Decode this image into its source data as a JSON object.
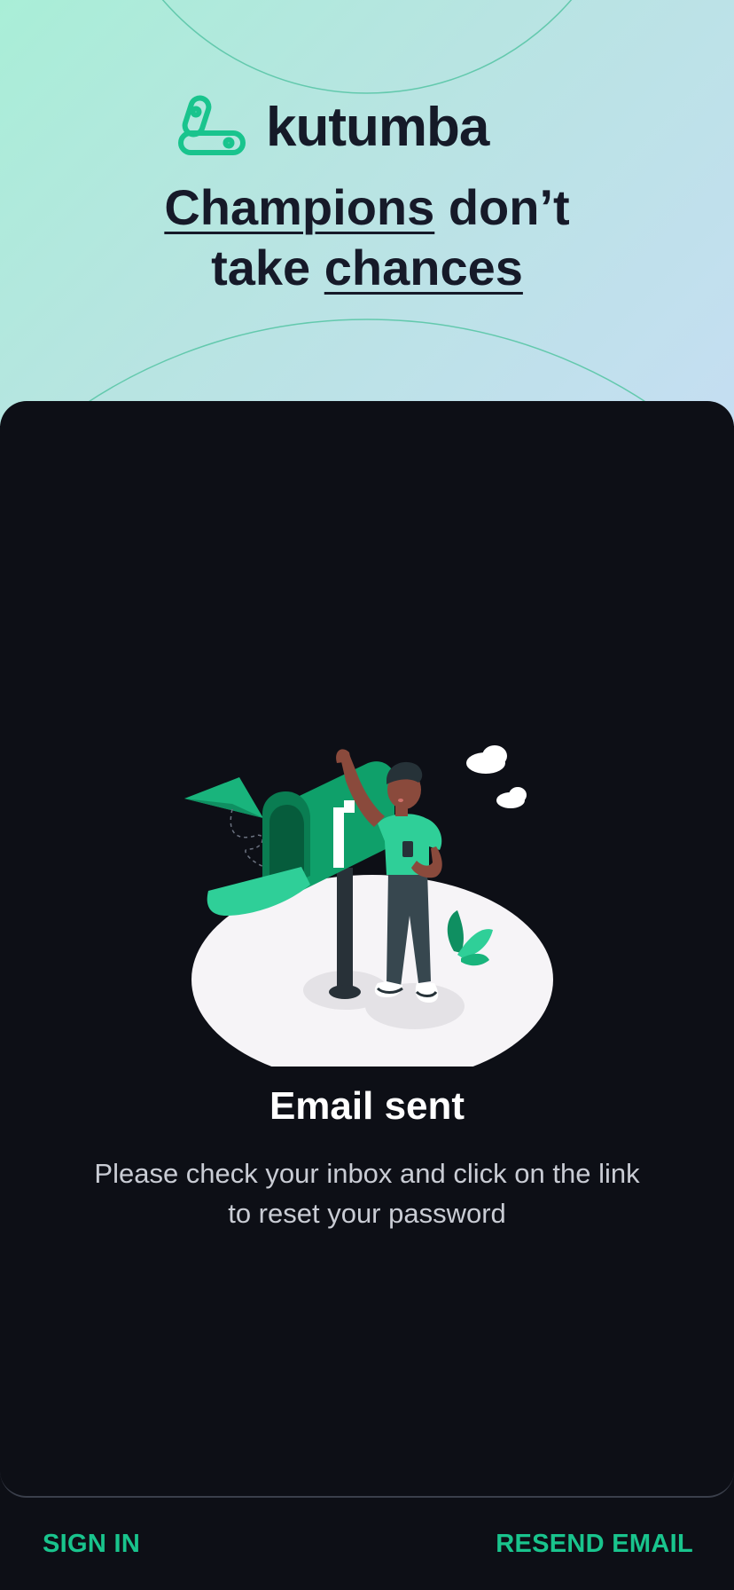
{
  "brand": {
    "name": "kutumba",
    "accent_color": "#19c48d",
    "logo_icon": "kutumba-logo-icon"
  },
  "hero": {
    "tagline_word1": "Champions",
    "tagline_word2": " don’t",
    "tagline_word3": "take ",
    "tagline_word4": "chances"
  },
  "card": {
    "illustration": "mailbox-person-illustration",
    "title": "Email sent",
    "message": "Please check your inbox and click on the link to reset your password"
  },
  "footer": {
    "sign_in_label": "SIGN IN",
    "resend_label": "RESEND EMAIL"
  }
}
